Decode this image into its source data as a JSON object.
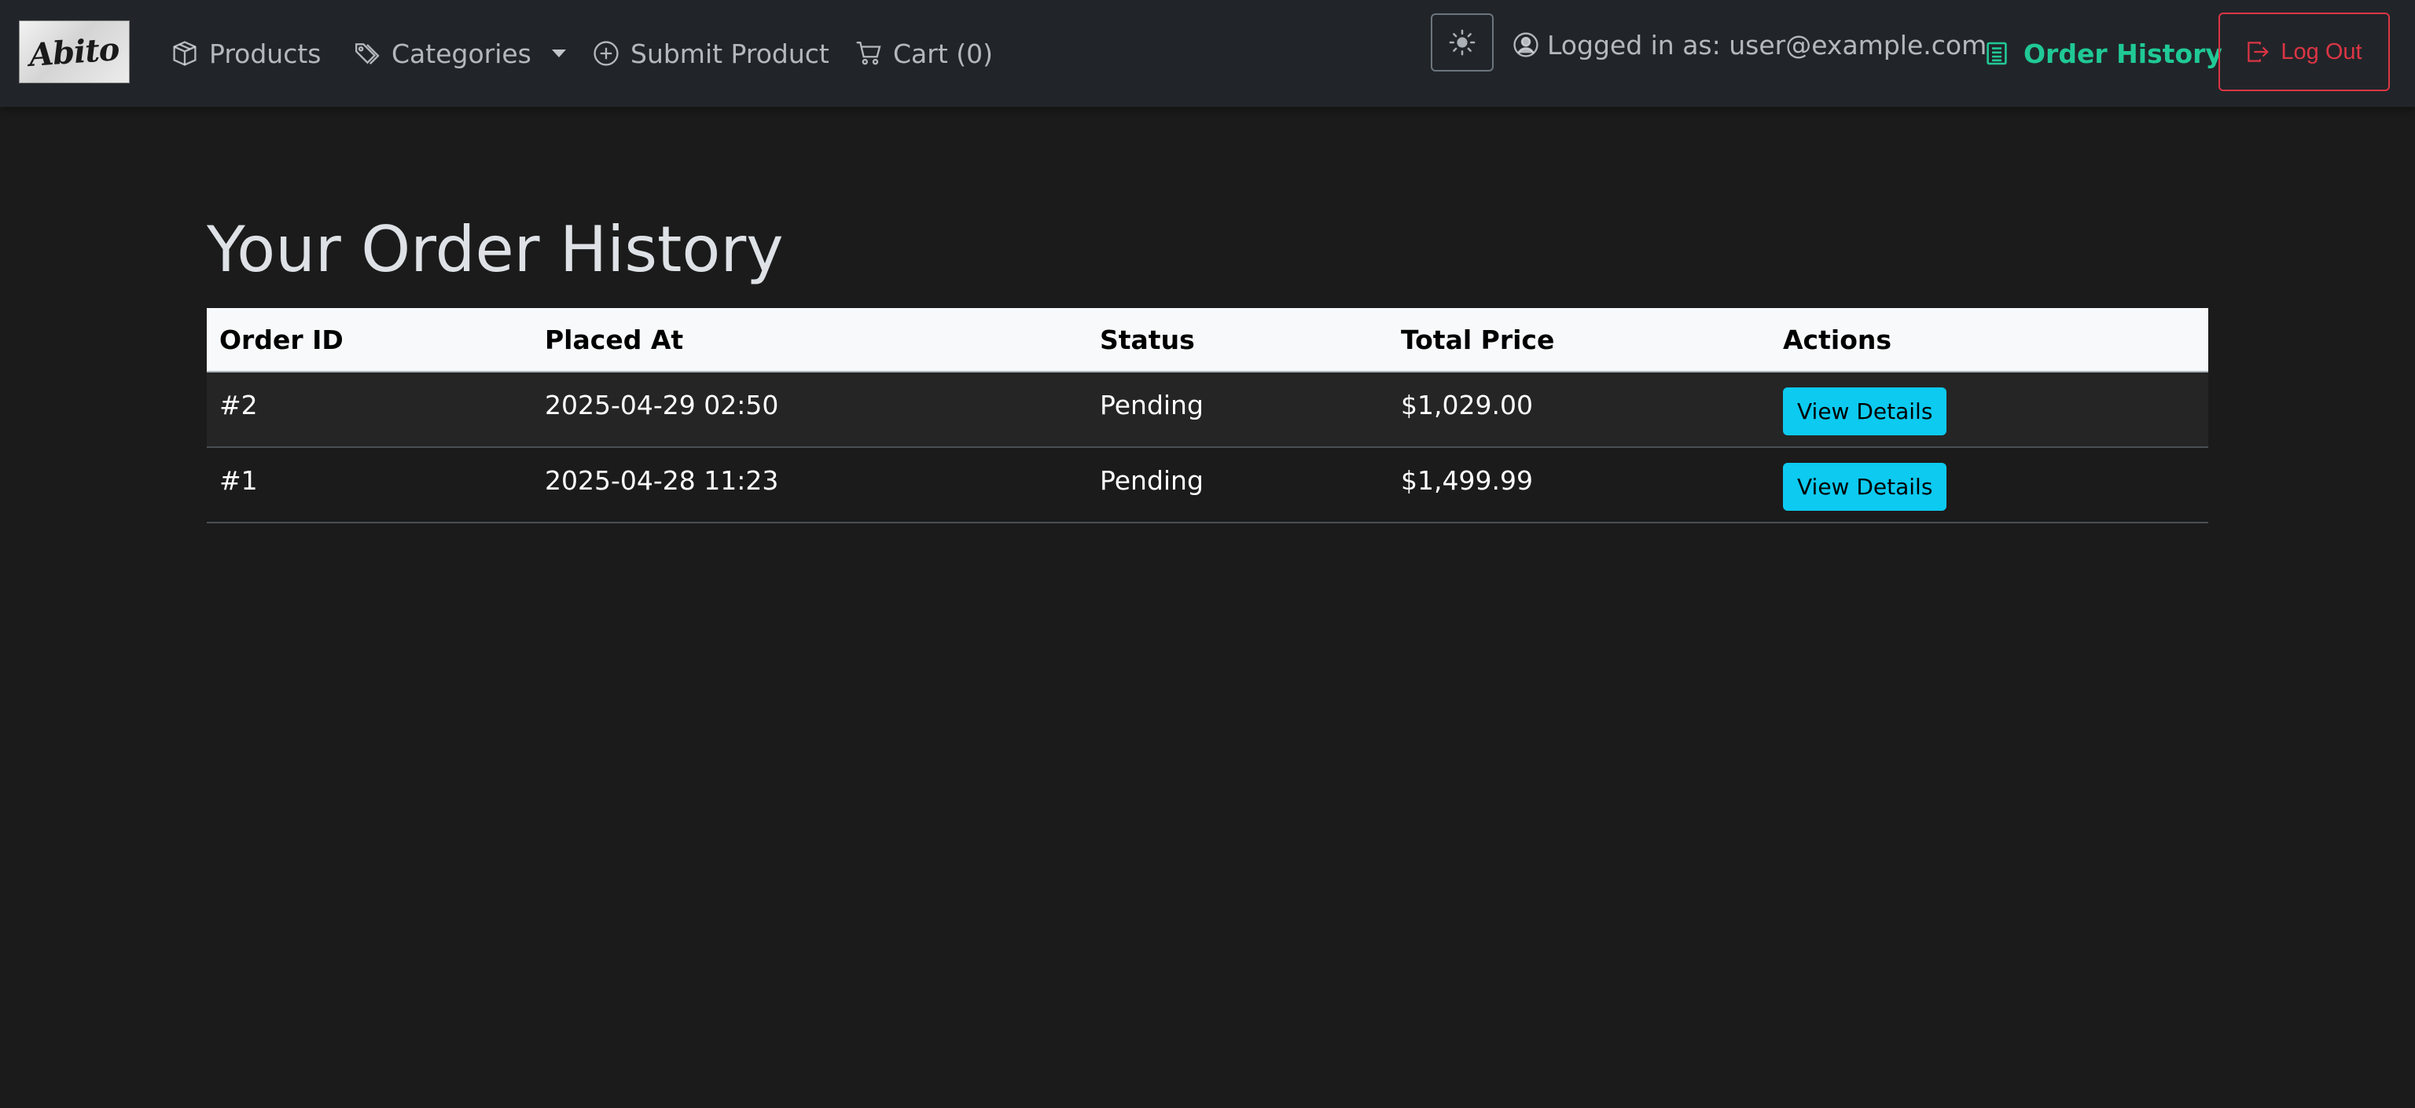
{
  "navbar": {
    "brand_text": "Abito",
    "items": [
      {
        "label": "Products",
        "icon": "box-icon"
      },
      {
        "label": "Categories",
        "icon": "tags-icon"
      },
      {
        "label": "Submit Product",
        "icon": "plus-circle-icon"
      },
      {
        "label": "Cart (0)",
        "icon": "cart-icon"
      }
    ],
    "theme_toggle_icon": "sun-icon",
    "logged_in_label": "Logged in as: user@example.com",
    "order_history_label": "Order History",
    "logout_label": "Log Out"
  },
  "colors": {
    "accent_green": "#20c997",
    "danger_red": "#dc3545",
    "info_cyan": "#0dcaf0",
    "navbar_bg": "#212529",
    "page_bg": "#1b1b1b"
  },
  "main": {
    "title": "Your Order History",
    "table": {
      "headers": [
        "Order ID",
        "Placed At",
        "Status",
        "Total Price",
        "Actions"
      ],
      "rows": [
        {
          "id": "#2",
          "placed_at": "2025-04-29 02:50",
          "status": "Pending",
          "total": "$1,029.00",
          "action": "View Details"
        },
        {
          "id": "#1",
          "placed_at": "2025-04-28 11:23",
          "status": "Pending",
          "total": "$1,499.99",
          "action": "View Details"
        }
      ]
    }
  }
}
